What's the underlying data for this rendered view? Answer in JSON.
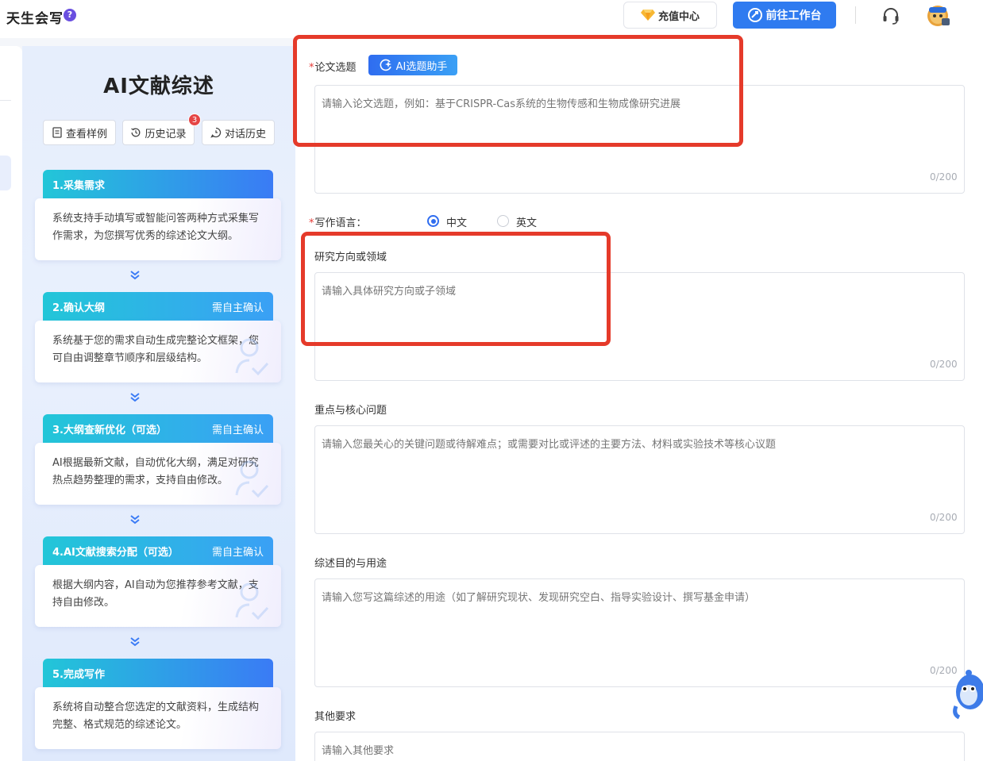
{
  "header": {
    "brand": "天生会写",
    "help_symbol": "?",
    "recharge_label": "充值中心",
    "workbench_label": "前往工作台",
    "icons": [
      "diamond-icon",
      "workbench-icon",
      "headset-icon",
      "avatar"
    ]
  },
  "sidebar": {
    "title": "AI文献综述",
    "buttons": {
      "samples": "查看样例",
      "history": "历史记录",
      "history_badge": "3",
      "chat_history": "对话历史"
    },
    "steps": [
      {
        "title": "1.采集需求",
        "tag": "",
        "desc": "系统支持手动填写或智能问答两种方式采集写作需求，为您撰写优秀的综述论文大纲。"
      },
      {
        "title": "2.确认大纲",
        "tag": "需自主确认",
        "desc": "系统基于您的需求自动生成完整论文框架，您可自由调整章节顺序和层级结构。"
      },
      {
        "title": "3.大纲查新优化（可选）",
        "tag": "需自主确认",
        "desc": "AI根据最新文献，自动优化大纲，满足对研究热点趋势整理的需求，支持自由修改。"
      },
      {
        "title": "4.AI文献搜索分配（可选）",
        "tag": "需自主确认",
        "desc": "根据大纲内容，AI自动为您推荐参考文献，支持自由修改。"
      },
      {
        "title": "5.完成写作",
        "tag": "",
        "desc": "系统将自动整合您选定的文献资料，生成结构完整、格式规范的综述论文。"
      }
    ]
  },
  "form": {
    "topic": {
      "label": "论文选题",
      "required": "*",
      "ai_button": "AI选题助手",
      "placeholder": "请输入论文选题，例如：基于CRISPR-Cas系统的生物传感和生物成像研究进展",
      "counter": "0/200"
    },
    "language": {
      "label": "写作语言：",
      "required": "*",
      "options": [
        "中文",
        "英文"
      ],
      "selected": "中文"
    },
    "direction": {
      "label": "研究方向或领域",
      "placeholder": "请输入具体研究方向或子领域",
      "counter": "0/200"
    },
    "focus": {
      "label": "重点与核心问题",
      "placeholder": "请输入您最关心的关键问题或待解难点；或需要对比或评述的主要方法、材料或实验技术等核心议题",
      "counter": "0/200"
    },
    "purpose": {
      "label": "综述目的与用途",
      "placeholder": "请输入您写这篇综述的用途（如了解研究现状、发现研究空白、指导实验设计、撰写基金申请）",
      "counter": "0/200"
    },
    "other": {
      "label": "其他要求",
      "placeholder": "请输入其他要求"
    }
  },
  "colors": {
    "primary": "#2f6df0",
    "highlight": "#e53a2a",
    "step_head_blue": "#2f7bf0",
    "step_head_teal": "#22c6d8"
  }
}
